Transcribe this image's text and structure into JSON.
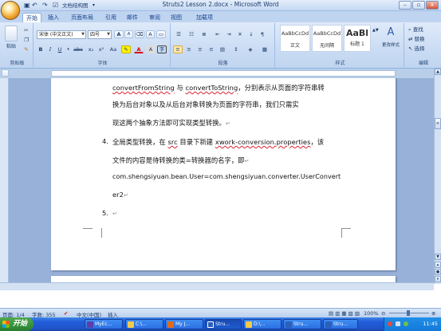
{
  "window": {
    "title": "Struts2 Lesson 2.docx - Microsoft Word",
    "qat_label": "文档结构图"
  },
  "tabs": [
    "开始",
    "插入",
    "页面布局",
    "引用",
    "邮件",
    "审阅",
    "视图",
    "加载项"
  ],
  "ribbon": {
    "clipboard": {
      "paste": "粘贴",
      "label": "剪贴板"
    },
    "font": {
      "name": "宋体 (中文正文)",
      "size": "四号",
      "label": "字体",
      "bold": "B",
      "italic": "I",
      "underline": "U",
      "strike": "abc",
      "sub": "x₂",
      "sup": "x²",
      "clear": "Aa",
      "change_case": "A",
      "grow": "A",
      "shrink": "A"
    },
    "paragraph": {
      "label": "段落"
    },
    "styles": {
      "label": "样式",
      "items": [
        {
          "preview": "AaBbCcDd",
          "name": "正文"
        },
        {
          "preview": "AaBbCcDd",
          "name": "无间隔"
        },
        {
          "preview": "AaBl",
          "name": "标题 1"
        }
      ],
      "change": "更改样式"
    },
    "editing": {
      "label": "编辑",
      "find": "查找",
      "replace": "替换",
      "select": "选择"
    }
  },
  "document": {
    "line1a": "convertFromString",
    "line1b": " 与 ",
    "line1c": "convertToString",
    "line1d": "，分别表示从页面的字符串转",
    "line2": "换为后台对象以及从后台对象转换为页面的字符串，我们只需实",
    "line3": "现这两个抽象方法即可实现类型转换。",
    "item4_num": "4.",
    "item4a": "全局类型转换，在 ",
    "item4b": "src",
    "item4c": " 目录下新建 ",
    "item4d": "xwork-conversion.properties",
    "item4e": "，该",
    "line5": "文件的内容是待转换的类=转换器的名字，即",
    "line6": "com.shengsiyuan.bean.User=com.shengsiyuan.converter.UserConvert",
    "line7": "er2",
    "item5_num": "5.",
    "para_mark": "↵"
  },
  "status": {
    "page": "页面: 1/4",
    "words": "字数: 355",
    "lang": "中文(中国)",
    "mode": "插入",
    "zoom": "100%"
  },
  "taskbar": {
    "start": "开始",
    "items": [
      "MyEc...",
      "C:\\...",
      "My J...",
      "Stru...",
      "D:\\...",
      "Stru...",
      "Stru..."
    ],
    "clock": "11:45"
  }
}
